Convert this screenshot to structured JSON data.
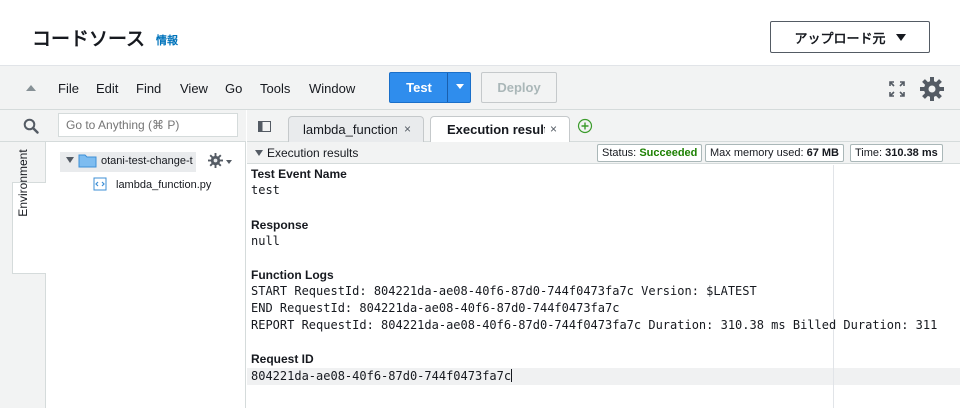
{
  "header": {
    "title": "コードソース",
    "info_link": "情報",
    "upload_button": "アップロード元"
  },
  "menubar": {
    "items": [
      "File",
      "Edit",
      "Find",
      "View",
      "Go",
      "Tools",
      "Window"
    ],
    "test_button": "Test",
    "deploy_button": "Deploy"
  },
  "sidebar": {
    "search_placeholder": "Go to Anything (⌘ P)",
    "environment_tab": "Environment",
    "folder_name": "otani-test-change-t",
    "file_name": "lambda_function.py"
  },
  "tabs": {
    "items": [
      {
        "label": "lambda_function",
        "active": false
      },
      {
        "label": "Execution results",
        "active": true
      }
    ],
    "close_glyph": "×"
  },
  "results": {
    "panel_title": "Execution results",
    "status_label": "Status:",
    "status_value": "Succeeded",
    "memory_label": "Max memory used:",
    "memory_value": "67 MB",
    "time_label": "Time:",
    "time_value": "310.38 ms",
    "test_event_name_label": "Test Event Name",
    "test_event_name": "test",
    "response_label": "Response",
    "response": "null",
    "function_logs_label": "Function Logs",
    "logs": [
      "START RequestId: 804221da-ae08-40f6-87d0-744f0473fa7c Version: $LATEST",
      "END RequestId: 804221da-ae08-40f6-87d0-744f0473fa7c",
      "REPORT RequestId: 804221da-ae08-40f6-87d0-744f0473fa7c  Duration: 310.38 ms Billed Duration: 311"
    ],
    "request_id_label": "Request ID",
    "request_id": "804221da-ae08-40f6-87d0-744f0473fa7c"
  },
  "colors": {
    "primary": "#2f8ded",
    "link": "#0073bb",
    "success": "#1d8102",
    "chrome": "#f2f3f3"
  }
}
